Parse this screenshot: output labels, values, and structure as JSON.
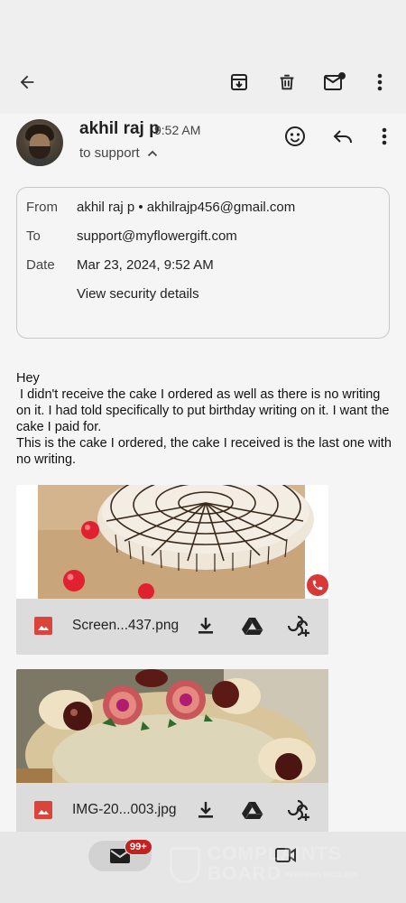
{
  "toolbar": {
    "back_icon": "arrow-back-icon",
    "archive_icon": "archive-icon",
    "delete_icon": "trash-icon",
    "mark_unread_icon": "mark-unread-icon",
    "more_icon": "more-vert-icon"
  },
  "message": {
    "sender_name": "akhil raj p",
    "time": "9:52 AM",
    "to_line": "to support",
    "actions": {
      "emoji_icon": "emoji-icon",
      "reply_icon": "reply-icon",
      "more_icon": "more-vert-icon"
    }
  },
  "details": {
    "from_label": "From",
    "from_value": "akhil raj p • akhilrajp456@gmail.com",
    "to_label": "To",
    "to_value": "support@myflowergift.com",
    "date_label": "Date",
    "date_value": "Mar 23, 2024, 9:52 AM",
    "security_link": "View security details"
  },
  "body": "Hey\n I didn't receive the cake I ordered as well as there is no writing on it. I had told specifically to put birthday writing on it. I want the cake I paid for.\nThis is the cake I ordered, the cake I received is the last one with no writing.",
  "attachments": [
    {
      "filename": "Screen...437.png"
    },
    {
      "filename": "IMG-20...003.jpg"
    }
  ],
  "bottom_nav": {
    "mail_badge": "99+"
  },
  "watermark": {
    "line1": "COMPLAINTS",
    "line2": "BOARD",
    "line3": "REVIEWING SINCE 2005"
  },
  "colors": {
    "accent_red": "#c5221f",
    "file_icon_red": "#d9443b"
  }
}
